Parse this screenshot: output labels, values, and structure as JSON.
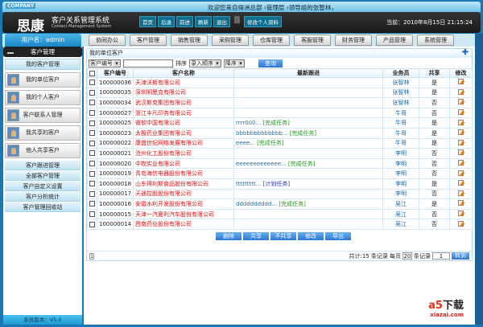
{
  "header": {
    "company": "COMPANY",
    "welcome": "欢迎您来自得洲总部 ›管理层 ›领导组的张智林，",
    "logo": "思康",
    "system_name": "客户关系管理系统",
    "system_name_en": "Contact Management System",
    "nav": [
      "首页",
      "后退",
      "前进",
      "刷新",
      "退出"
    ],
    "edit_profile": "修改个人资料",
    "clock": "当前：2010年8月15日 21:15:24"
  },
  "user_label": "用户名：admin",
  "tabs": [
    "协同办公",
    "客户管理",
    "销售管理",
    "采购管理",
    "仓库管理",
    "客服管理",
    "财务管理",
    "产品管理",
    "系统管理"
  ],
  "sidebar": {
    "title": "客户管理",
    "group1": "我的客户管理",
    "sub": [
      "我的单位客户",
      "我的个人客户",
      "客户联系人管理",
      "我共享的客户",
      "他人共享客户"
    ],
    "items": [
      "客户跟进管理",
      "全部客户管理",
      "客户自定义设置",
      "客户分析统计",
      "客户管理回收站"
    ],
    "version": "系统版本：V5.0"
  },
  "panel": {
    "title": "我的单位客户",
    "filter_field": "客户编号",
    "sort_label": "排序",
    "sort_field": "录入顺序",
    "sort_order": "降序",
    "query": "查询"
  },
  "columns": [
    "客户编号",
    "客户名称",
    "最新跟进",
    "业务员",
    "共享",
    "修改"
  ],
  "rows": [
    [
      "100000036",
      "天津沃斯有限公司",
      "",
      "",
      "张智林",
      "是"
    ],
    [
      "100000035",
      "深圳明思克有限公司",
      "",
      "",
      "张智林",
      "是"
    ],
    [
      "100000034",
      "武汉斯克集团有限公司",
      "",
      "",
      "张智林",
      "否"
    ],
    [
      "100000027",
      "浙江丰凡印务有限公司",
      "",
      "",
      "牛哥",
      "否"
    ],
    [
      "100000025",
      "微软中国有限公司",
      "rrrr000...",
      "[完成任务]",
      "牛哥",
      "是"
    ],
    [
      "100000023",
      "太极药业集团有限公司",
      "bbbbbbbbbbbbb...",
      "[完成任务]",
      "牛哥",
      "是"
    ],
    [
      "100000022",
      "康盛世纪网络发展有限公司",
      "eeee...",
      "[完成任务]",
      "牛哥",
      "是"
    ],
    [
      "100000021",
      "沧州化工股份有限公司",
      "",
      "",
      "李明",
      "否"
    ],
    [
      "100000020",
      "中牧实业有限公司",
      "eeeeeeeeeeeee...",
      "[完成任务]",
      "李明",
      "否"
    ],
    [
      "100000019",
      "青岛海信电器股份有限公司",
      "",
      "",
      "李明",
      "否"
    ],
    [
      "100000018",
      "山东得利斯食品股份有限公司",
      "ttttttttt...",
      "[计划任务]",
      "李明",
      "是"
    ],
    [
      "100000017",
      "天通控股股份有限公司",
      "",
      "",
      "李明",
      "否"
    ],
    [
      "100000016",
      "安徽水利开发股份有限公司",
      "dddddddddd...",
      "[完成任务]",
      "吴江",
      "是"
    ],
    [
      "100000015",
      "天津一汽夏利汽车股份有限公司",
      "",
      "",
      "吴江",
      "否"
    ],
    [
      "100000014",
      "西南药业股份有限公司",
      "",
      "",
      "吴江",
      "否"
    ]
  ],
  "actions": [
    "删除",
    "共享",
    "不共享",
    "修改",
    "导出"
  ],
  "pager": {
    "page": "1",
    "total": "共计:15 条记录",
    "per_page_label": "每页",
    "per_page": "20",
    "unit": "条记录",
    "goto": "1",
    "go": "转到"
  },
  "watermark": {
    "brand": "a5下载",
    "url": "xiazai.com"
  }
}
